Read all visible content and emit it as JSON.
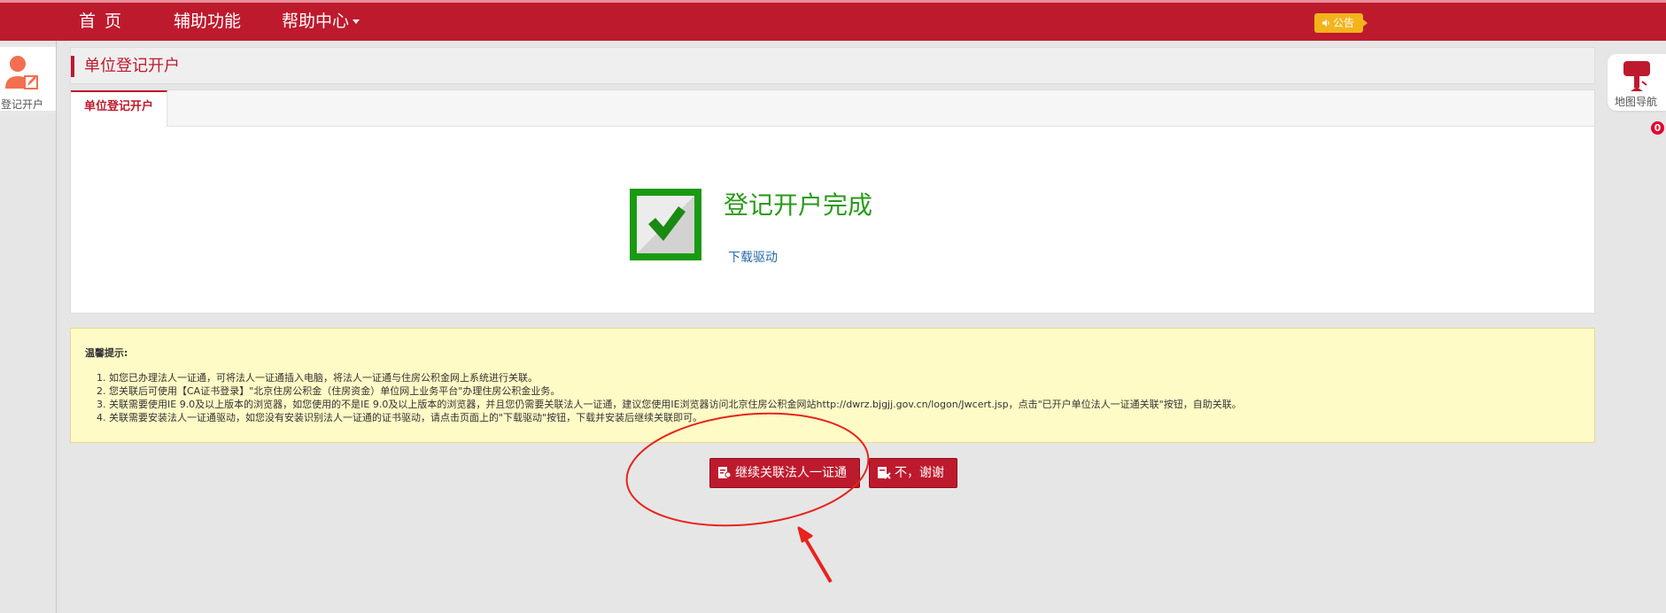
{
  "nav": {
    "home": "首页",
    "aux": "辅助功能",
    "help": "帮助中心",
    "notice": "公告"
  },
  "left_sidebar": {
    "item_label": "登记开户"
  },
  "right_sidebar": {
    "map_nav_label": "地图导航",
    "badge_count": "0"
  },
  "page": {
    "title": "单位登记开户",
    "tab_label": "单位登记开户",
    "success_title": "登记开户完成",
    "download_link": "下载驱动"
  },
  "tips": {
    "title": "温馨提示:",
    "items": [
      "如您已办理法人一证通，可将法人一证通插入电脑，将法人一证通与住房公积金网上系统进行关联。",
      "您关联后可使用【CA证书登录】\"北京住房公积金（住房资金）单位网上业务平台\"办理住房公积金业务。",
      "关联需要使用IE 9.0及以上版本的浏览器，如您使用的不是IE 9.0及以上版本的浏览器，并且您仍需要关联法人一证通，建议您使用IE浏览器访问北京住房公积金网站http://dwrz.bjgjj.gov.cn/logon/Jwcert.jsp，点击\"已开户单位法人一证通关联\"按钮，自助关联。",
      "关联需要安装法人一证通驱动，如您没有安装识别法人一证通的证书驱动，请点击页面上的\"下载驱动\"按钮，下载并安装后继续关联即可。"
    ]
  },
  "actions": {
    "continue_label": "继续关联法人一证通",
    "decline_label": "不，谢谢"
  },
  "colors": {
    "brand_red": "#be1a2d",
    "success_green": "#2a9a1a",
    "notice_yellow": "#f3b31b",
    "tips_bg": "#fffbc6",
    "annotation_red": "#e8231d"
  },
  "icons": {
    "notice": "speaker-icon",
    "left_item": "user-edit-icon",
    "right_item": "map-navigation-icon",
    "success": "checkmark-icon",
    "buttons": "certificate-icon"
  }
}
